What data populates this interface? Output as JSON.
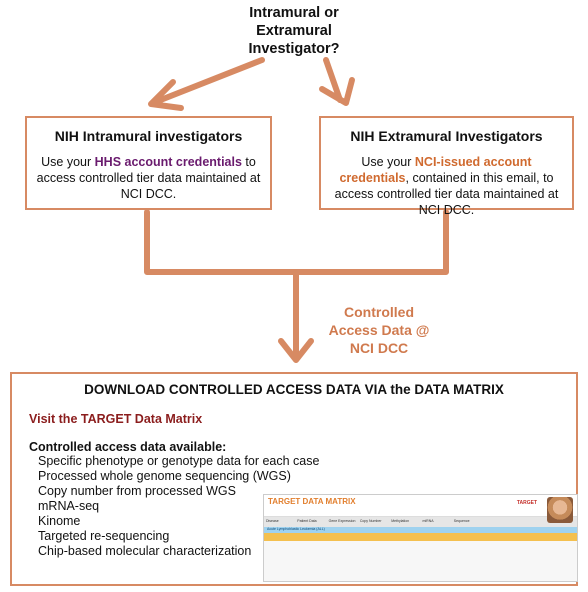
{
  "top_question": [
    "Intramural or",
    "Extramural",
    "Investigator?"
  ],
  "intramural": {
    "heading": "NIH Intramural investigators",
    "text_before": "Use your ",
    "highlight": "HHS account credentials",
    "text_after": " to access controlled tier data maintained at NCI DCC."
  },
  "extramural": {
    "heading": "NIH Extramural Investigators",
    "text_before": "Use your ",
    "highlight": "NCI-issued account credentials",
    "text_after": ", contained in this email, to access controlled tier data maintained at NCI DCC."
  },
  "controlled_label": [
    "Controlled",
    "Access Data @",
    "NCI DCC"
  ],
  "download": {
    "title": "DOWNLOAD CONTROLLED ACCESS DATA VIA the DATA MATRIX",
    "visit_link": "Visit the TARGET Data Matrix",
    "available_heading": "Controlled access data available:",
    "items": [
      "Specific phenotype or genotype data for each case",
      "Processed whole genome sequencing (WGS)",
      "Copy number from processed WGS",
      "mRNA-seq",
      "Kinome",
      " Targeted re-sequencing",
      " Chip-based molecular characterization"
    ]
  },
  "matrix_thumbnail": {
    "title": "TARGET DATA MATRIX",
    "logo": "TARGET",
    "columns": [
      "Disease",
      "Patient Data",
      "Gene Expression",
      "Copy Number",
      "Methylation",
      "miRNA",
      "Sequence",
      "",
      "",
      "Other"
    ],
    "category": "Acute Lymphoblastic Leukemia (ALL)"
  },
  "colors": {
    "accent": "#d78a63",
    "purple": "#6a1b6e",
    "orange": "#d06a2f",
    "link": "#8b1d1d"
  }
}
